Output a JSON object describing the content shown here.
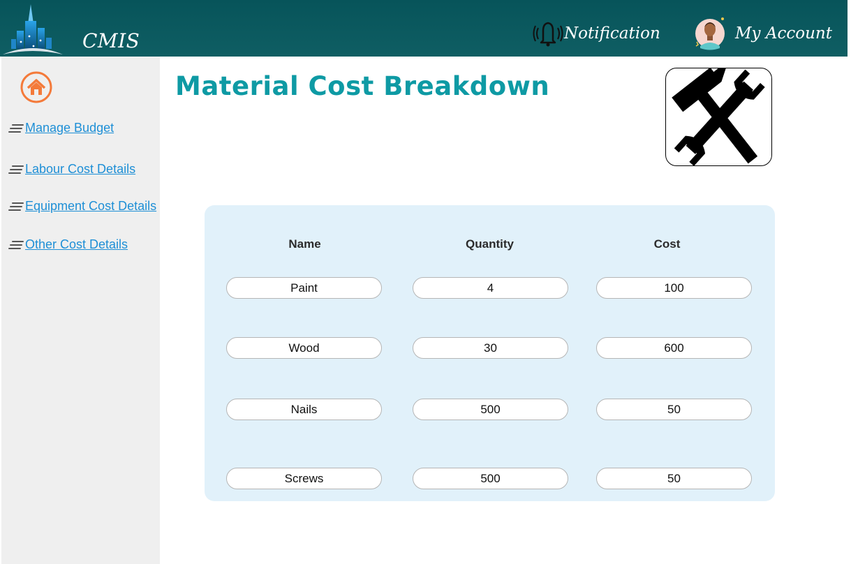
{
  "header": {
    "brand": "CMIS",
    "notification_label": "Notification",
    "account_label": "My Account"
  },
  "sidebar": {
    "items": [
      {
        "label": "Manage Budget"
      },
      {
        "label": "Labour Cost Details"
      },
      {
        "label": "Equipment Cost Details"
      },
      {
        "label": "Other Cost Details"
      }
    ]
  },
  "main": {
    "title": "Material Cost Breakdown",
    "table": {
      "columns": [
        "Name",
        "Quantity",
        "Cost"
      ],
      "rows": [
        {
          "name": "Paint",
          "quantity": "4",
          "cost": "100"
        },
        {
          "name": "Wood",
          "quantity": "30",
          "cost": "600"
        },
        {
          "name": "Nails",
          "quantity": "500",
          "cost": "50"
        },
        {
          "name": "Screws",
          "quantity": "500",
          "cost": "50"
        }
      ]
    }
  },
  "icons": {
    "logo": "city-skyline-logo",
    "notification": "bell-icon",
    "account": "user-avatar",
    "home": "home-icon",
    "nav": "menu-lines-icon",
    "tools": "hammer-wrench-icon"
  },
  "colors": {
    "header_bg": "#07545a",
    "title": "#0e9aa4",
    "link": "#1e8fd6",
    "home_accent": "#f47a3a",
    "panel_bg": "#e1f1fa",
    "sidebar_bg": "#efefef"
  }
}
